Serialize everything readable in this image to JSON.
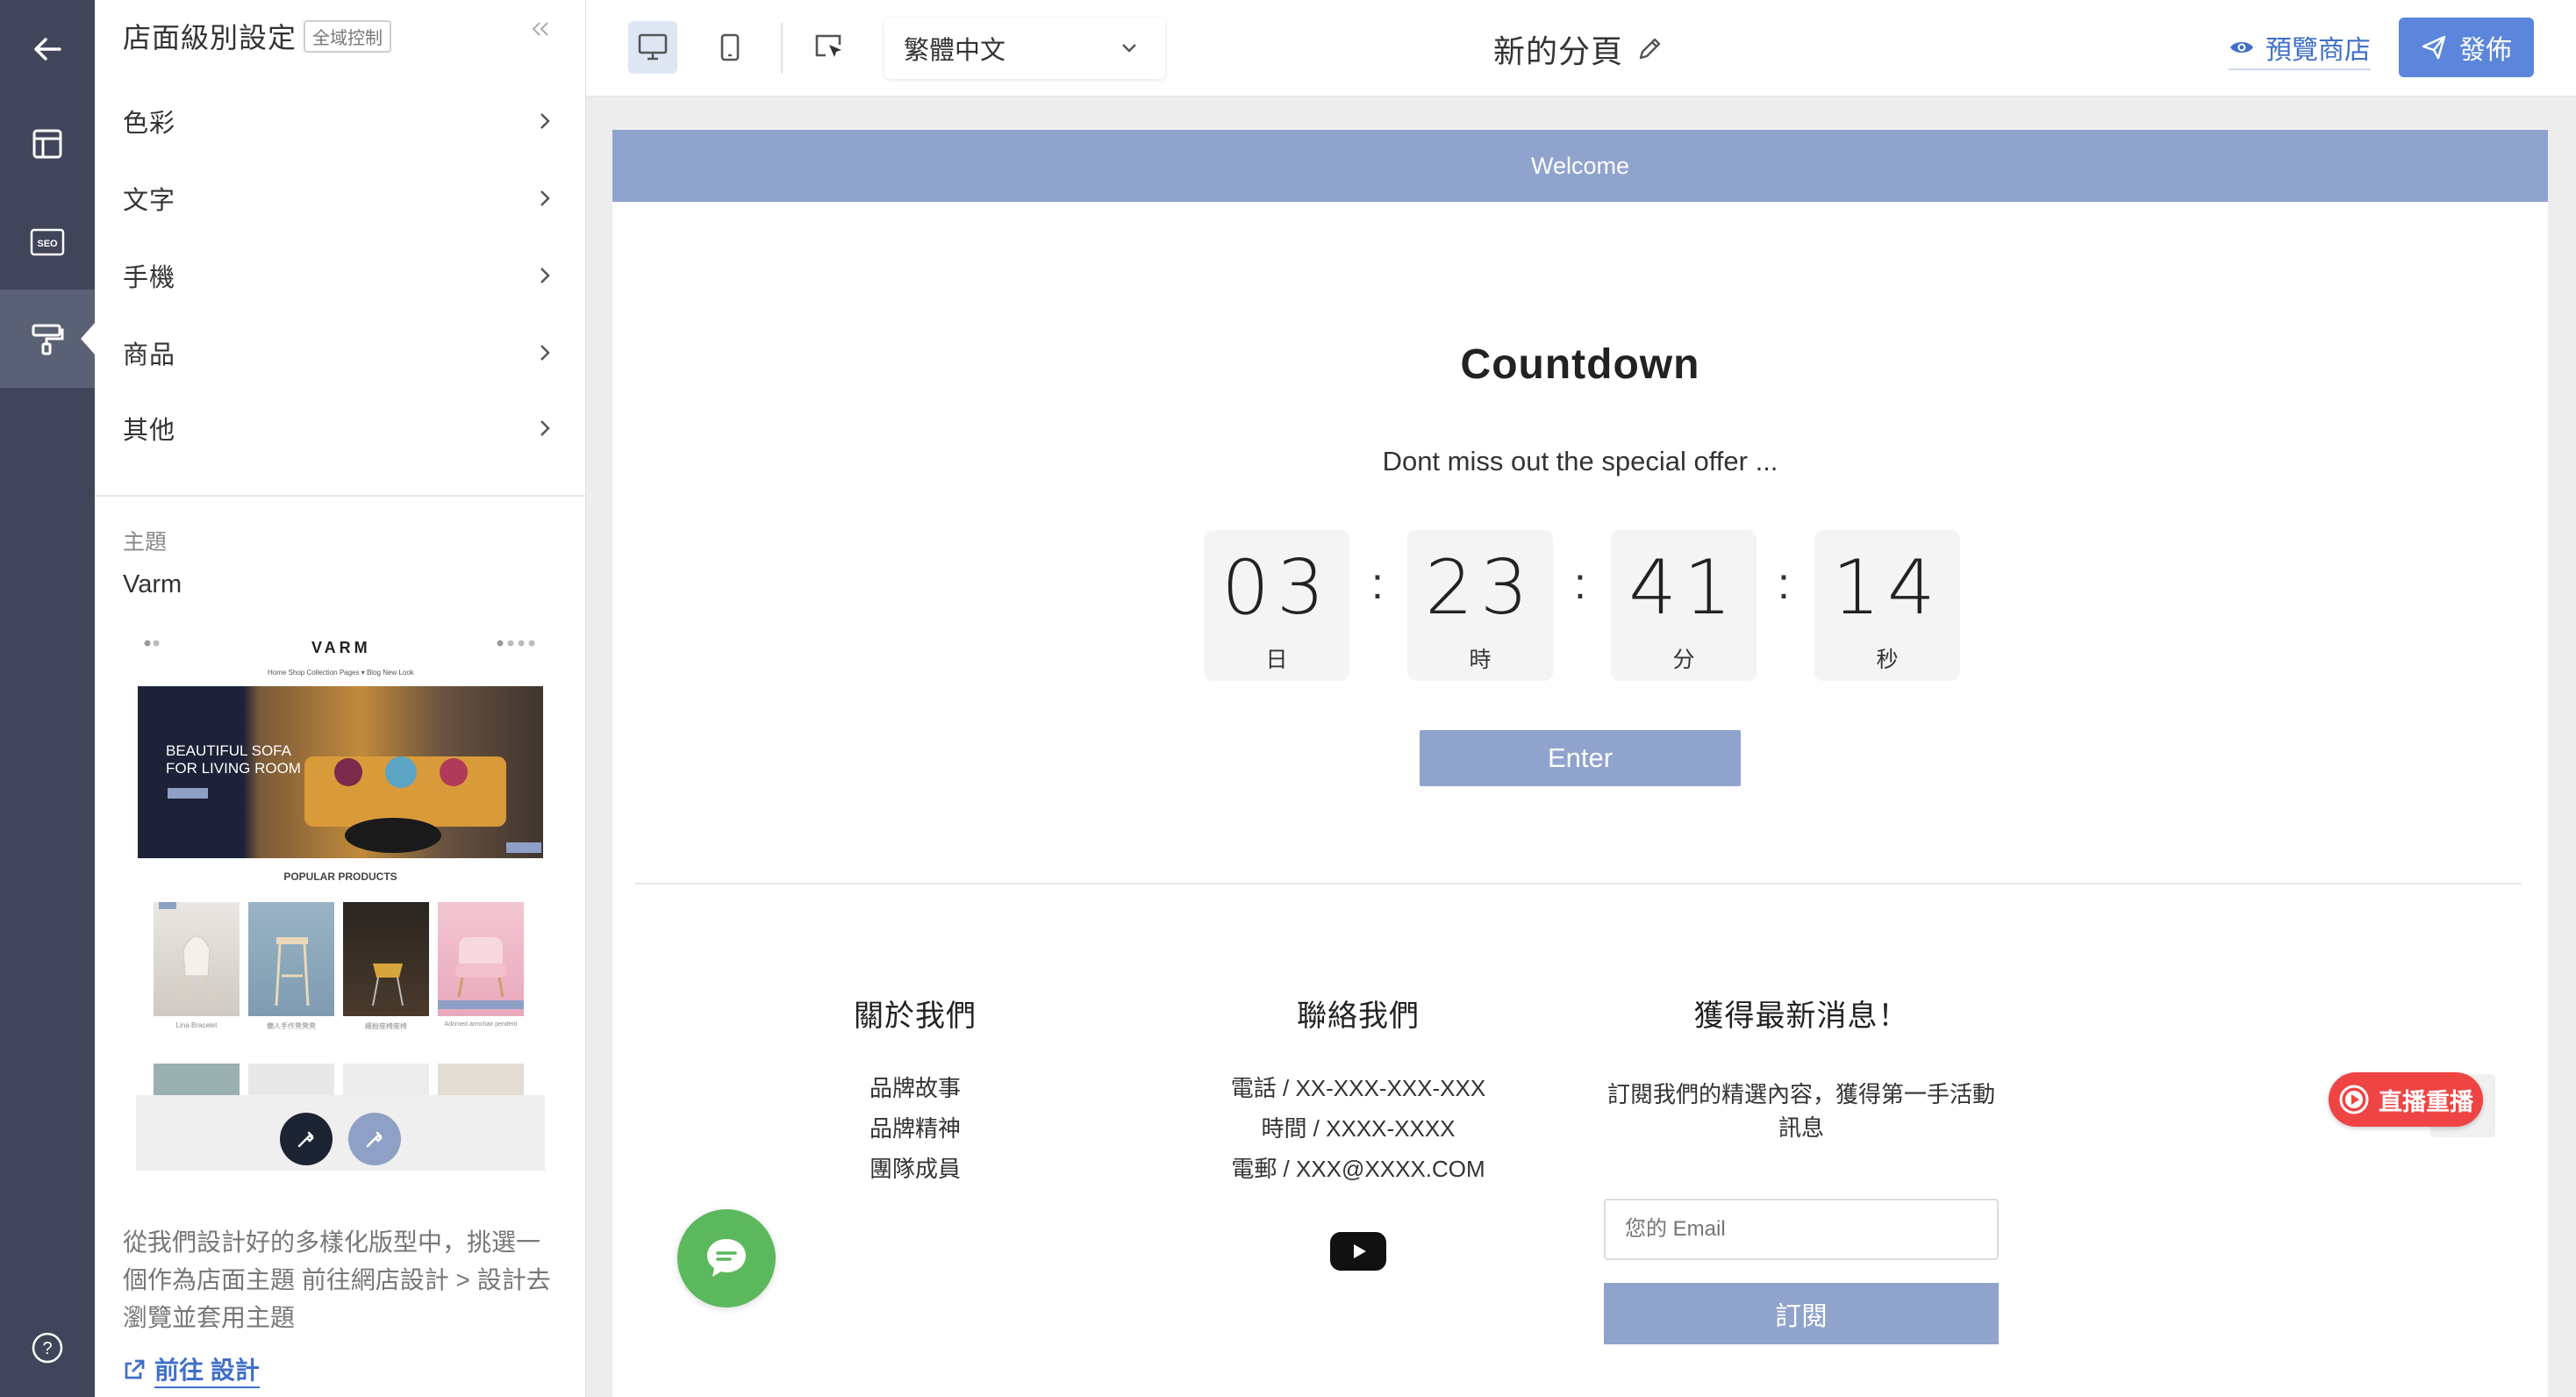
{
  "rail": {
    "items": [
      {
        "icon": "back-arrow-icon"
      },
      {
        "icon": "layout-icon"
      },
      {
        "icon": "seo-icon",
        "label": "SEO"
      },
      {
        "icon": "paint-roller-icon",
        "active": true
      },
      {
        "icon": "help-icon",
        "label": "?"
      }
    ]
  },
  "panel": {
    "title": "店面級別設定",
    "tag": "全域控制",
    "collapse_icon": "«",
    "menu": [
      {
        "label": "色彩"
      },
      {
        "label": "文字"
      },
      {
        "label": "手機"
      },
      {
        "label": "商品"
      },
      {
        "label": "其他"
      }
    ],
    "theme_label": "主題",
    "theme_name": "Varm",
    "theme_preview": {
      "logo": "VARM",
      "nav": "Home   Shop   Collection   Pages ▾   Blog   New Look",
      "hero_text_line1": "BEAUTIFUL SOFA",
      "hero_text_line2": "FOR LIVING ROOM",
      "popular": "POPULAR PRODUCTS",
      "products": [
        "Lina Bracelet",
        "懶人手作凳凳凳",
        "繽紛座椅座椅",
        "Adorned armchair pendent"
      ]
    },
    "description": "從我們設計好的多樣化版型中，挑選一個作為店面主題 前往網店設計 > 設計去瀏覽並套用主題",
    "goto_label": "前往 設計"
  },
  "toolbar": {
    "language": "繁體中文",
    "page_name": "新的分頁",
    "preview_label": "預覽商店",
    "publish_label": "發佈"
  },
  "canvas": {
    "announcement": "Welcome",
    "countdown": {
      "title": "Countdown",
      "subtitle": "Dont miss out the special offer ...",
      "units": [
        {
          "value": "03",
          "label": "日"
        },
        {
          "value": "23",
          "label": "時"
        },
        {
          "value": "41",
          "label": "分"
        },
        {
          "value": "14",
          "label": "秒"
        }
      ],
      "separator": ":",
      "button": "Enter"
    },
    "footer": {
      "about": {
        "title": "關於我們",
        "links": [
          "品牌故事",
          "品牌精神",
          "團隊成員"
        ]
      },
      "contact": {
        "title": "聯絡我們",
        "lines": [
          "電話 / XX-XXX-XXX-XXX",
          "時間 / XXXX-XXXX",
          "電郵 / XXX@XXXX.COM"
        ]
      },
      "newsletter": {
        "title": "獲得最新消息！",
        "description": "訂閱我們的精選內容，獲得第一手活動訊息",
        "email_placeholder": "您的 Email",
        "subscribe_label": "訂閱"
      }
    },
    "live_badge": "直播重播"
  },
  "colors": {
    "rail_bg": "#40455a",
    "accent_blue": "#5b86db",
    "brand_periwinkle": "#8fa3cd",
    "live_red": "#ef4444",
    "chat_green": "#5cb85c"
  }
}
